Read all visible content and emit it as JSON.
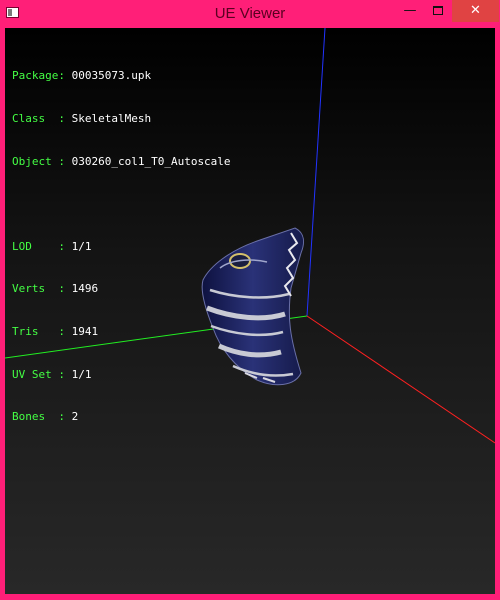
{
  "window": {
    "title": "UE Viewer",
    "controls": {
      "minimize": "—",
      "close": "✕"
    },
    "colors": {
      "frame": "#ff1f78",
      "close_button": "#e04343"
    }
  },
  "info": {
    "package_key": "Package:",
    "package": "00035073.upk",
    "class_key": "Class  :",
    "class": "SkeletalMesh",
    "object_key": "Object :",
    "object": "030260_col1_T0_Autoscale",
    "lod_key": "LOD    :",
    "lod": "1/1",
    "verts_key": "Verts  :",
    "verts": "1496",
    "tris_key": "Tris   :",
    "tris": "1941",
    "uvset_key": "UV Set :",
    "uvset": "1/1",
    "bones_key": "Bones  :",
    "bones": "2"
  },
  "scene": {
    "axes": {
      "x": "#ff2020",
      "y": "#22ee22",
      "z": "#2233ff"
    },
    "mesh": "skeletal-mesh-glove-piece"
  }
}
